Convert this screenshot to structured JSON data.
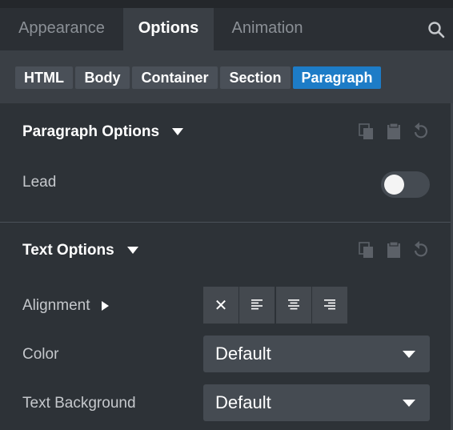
{
  "tabs": [
    "Appearance",
    "Options",
    "Animation"
  ],
  "active_tab": "Options",
  "breadcrumbs": [
    "HTML",
    "Body",
    "Container",
    "Section",
    "Paragraph"
  ],
  "active_breadcrumb": "Paragraph",
  "paragraph_options": {
    "title": "Paragraph Options",
    "lead_label": "Lead",
    "lead_on": false
  },
  "text_options": {
    "title": "Text Options",
    "alignment_label": "Alignment",
    "color_label": "Color",
    "color_value": "Default",
    "text_background_label": "Text Background",
    "text_background_value": "Default",
    "align_clear_glyph": "✕"
  },
  "icons": [
    "search-icon",
    "copy-icon",
    "paste-icon",
    "reset-icon",
    "align-left-icon",
    "align-center-icon",
    "align-right-icon"
  ],
  "colors": {
    "accent": "#1d7cc7",
    "background": "#2b2f34",
    "panel": "#2d3237"
  }
}
